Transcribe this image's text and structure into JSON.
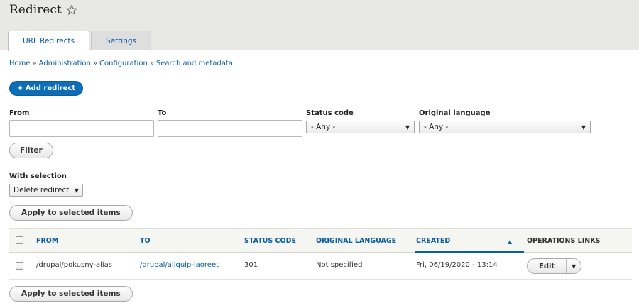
{
  "header": {
    "title": "Redirect",
    "tabs": [
      {
        "label": "URL Redirects",
        "active": true
      },
      {
        "label": "Settings",
        "active": false
      }
    ]
  },
  "breadcrumb": [
    "Home",
    "Administration",
    "Configuration",
    "Search and metadata"
  ],
  "breadcrumb_separator": "»",
  "add_button": "+ Add redirect",
  "filters": {
    "from_label": "From",
    "from_value": "",
    "to_label": "To",
    "to_value": "",
    "status_label": "Status code",
    "status_value": "- Any -",
    "language_label": "Original language",
    "language_value": "- Any -",
    "filter_button": "Filter"
  },
  "bulk": {
    "with_selection_label": "With selection",
    "action_value": "Delete redirect",
    "apply_button": "Apply to selected items"
  },
  "table": {
    "headers": [
      "FROM",
      "TO",
      "STATUS CODE",
      "ORIGINAL LANGUAGE",
      "CREATED",
      "OPERATIONS LINKS"
    ],
    "rows": [
      {
        "from": "/drupal/pokusny-alias",
        "to": "/drupal/aliquip-laoreet",
        "status": "301",
        "language": "Not specified",
        "created": "Fri, 06/19/2020 - 13:14",
        "operation": "Edit"
      }
    ]
  },
  "colors": {
    "link": "#0a5fa4",
    "primary_button": "#0d6eb5",
    "header_bg": "#e8e8e6"
  },
  "icons": [
    "star-icon",
    "chevron-down-icon",
    "sort-ascending-icon"
  ]
}
